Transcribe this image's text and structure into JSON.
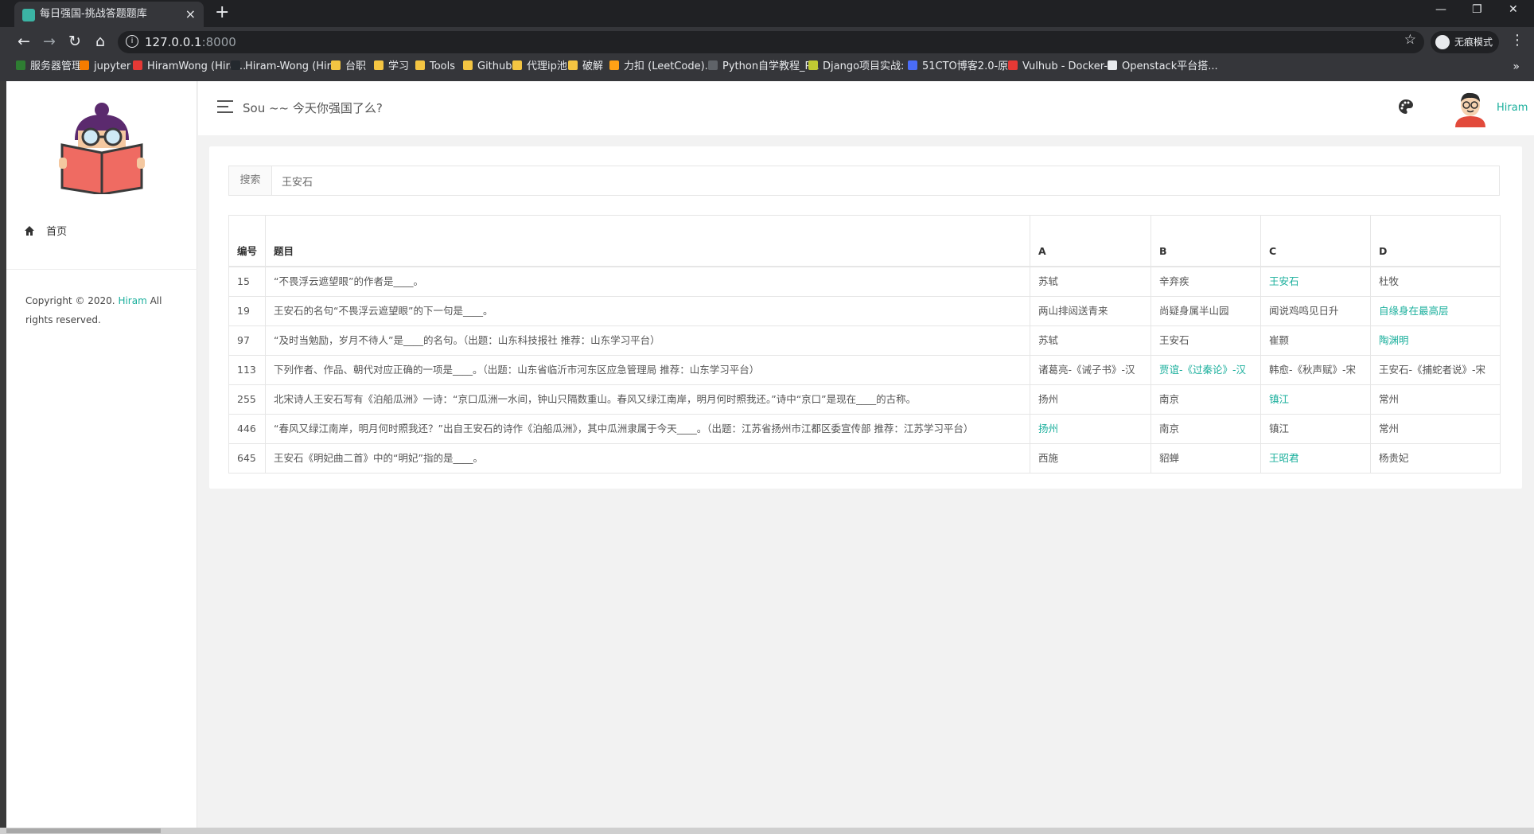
{
  "browser": {
    "tab_title": "每日强国-挑战答题题库",
    "url_host": "127.0.0.1",
    "url_port": ":8000",
    "incognito_label": "无痕模式",
    "bookmarks": [
      {
        "label": "服务器管理",
        "color": "#2e7d32"
      },
      {
        "label": "jupyter",
        "color": "#f57c00"
      },
      {
        "label": "HiramWong (Hira...",
        "color": "#e53935"
      },
      {
        "label": "Hiram-Wong (Hir...",
        "color": "#24292e"
      },
      {
        "label": "台职",
        "color": "#f4c542"
      },
      {
        "label": "学习",
        "color": "#f4c542"
      },
      {
        "label": "Tools",
        "color": "#f4c542"
      },
      {
        "label": "Github",
        "color": "#f4c542"
      },
      {
        "label": "代理ip池",
        "color": "#f4c542"
      },
      {
        "label": "破解",
        "color": "#f4c542"
      },
      {
        "label": "力扣 (LeetCode)...",
        "color": "#ffa116"
      },
      {
        "label": "Python自学教程_P...",
        "color": "#5f6368"
      },
      {
        "label": "Django项目实战: ...",
        "color": "#c0ca33"
      },
      {
        "label": "51CTO博客2.0-原...",
        "color": "#4a6cf7"
      },
      {
        "label": "Vulhub - Docker-...",
        "color": "#e53935"
      },
      {
        "label": "Openstack平台搭...",
        "color": "#e8eaed"
      }
    ]
  },
  "header": {
    "title": "Sou ~~ 今天你强国了么?",
    "username": "Hiram"
  },
  "sidebar": {
    "home_label": "首页",
    "copyright_prefix": "Copyright © 2020. ",
    "copyright_name": "Hiram",
    "copyright_suffix": " All rights reserved."
  },
  "search": {
    "label": "搜索",
    "value": "王安石"
  },
  "table": {
    "headers": [
      "编号",
      "题目",
      "A",
      "B",
      "C",
      "D"
    ],
    "rows": [
      {
        "id": "15",
        "question": "“不畏浮云遮望眼”的作者是____。",
        "options": [
          "苏轼",
          "辛弃疾",
          "王安石",
          "杜牧"
        ],
        "correct": 2
      },
      {
        "id": "19",
        "question": "王安石的名句“不畏浮云遮望眼”的下一句是____。",
        "options": [
          "两山排闼送青来",
          "尚疑身属半山园",
          "闻说鸡鸣见日升",
          "自缘身在最高层"
        ],
        "correct": 3
      },
      {
        "id": "97",
        "question": "“及时当勉励，岁月不待人”是____的名句。（出题：山东科技报社 推荐：山东学习平台）",
        "options": [
          "苏轼",
          "王安石",
          "崔颢",
          "陶渊明"
        ],
        "correct": 3
      },
      {
        "id": "113",
        "question": "下列作者、作品、朝代对应正确的一项是____。（出题：山东省临沂市河东区应急管理局 推荐：山东学习平台）",
        "options": [
          "诸葛亮-《诫子书》-汉",
          "贾谊-《过秦论》-汉",
          "韩愈-《秋声赋》-宋",
          "王安石-《捕蛇者说》-宋"
        ],
        "correct": 1
      },
      {
        "id": "255",
        "question": "北宋诗人王安石写有《泊船瓜洲》一诗：“京口瓜洲一水间，钟山只隔数重山。春风又绿江南岸，明月何时照我还。”诗中“京口”是现在____的古称。",
        "options": [
          "扬州",
          "南京",
          "镇江",
          "常州"
        ],
        "correct": 2
      },
      {
        "id": "446",
        "question": "“春风又绿江南岸，明月何时照我还？”出自王安石的诗作《泊船瓜洲》，其中瓜洲隶属于今天____。（出题：江苏省扬州市江都区委宣传部 推荐：江苏学习平台）",
        "options": [
          "扬州",
          "南京",
          "镇江",
          "常州"
        ],
        "correct": 0
      },
      {
        "id": "645",
        "question": "王安石《明妃曲二首》中的“明妃”指的是____。",
        "options": [
          "西施",
          "貂蝉",
          "王昭君",
          "杨贵妃"
        ],
        "correct": 2
      }
    ]
  },
  "colors": {
    "accent": "#1aaf9c"
  }
}
